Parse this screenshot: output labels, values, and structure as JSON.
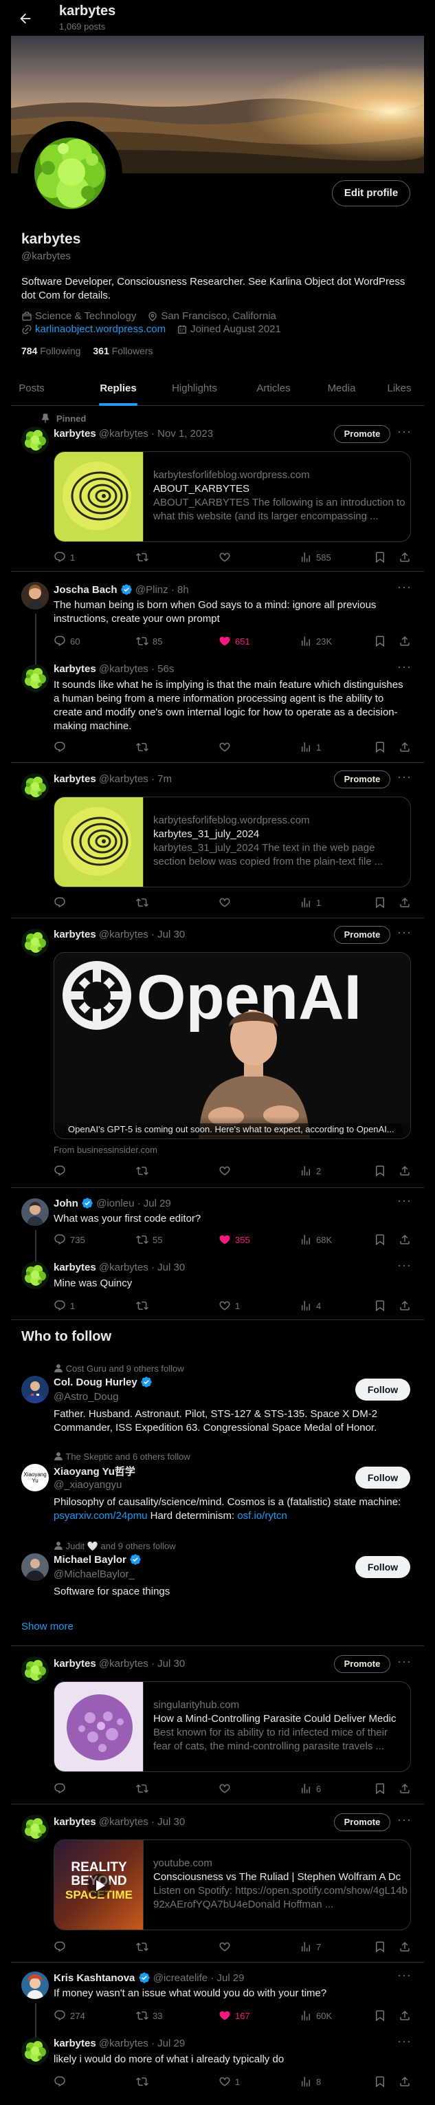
{
  "header": {
    "title": "karbytes",
    "post_count": "1,069 posts"
  },
  "profile": {
    "name": "karbytes",
    "handle": "@karbytes",
    "edit_label": "Edit profile",
    "bio": "Software Developer, Consciousness Researcher. See Karlina Object dot WordPress dot Com for details.",
    "category": "Science & Technology",
    "location": "San Francisco, California",
    "website": "karlinaobject.wordpress.com",
    "joined": "Joined August 2021",
    "following_count": "784",
    "following_label": "Following",
    "followers_count": "361",
    "followers_label": "Followers"
  },
  "tabs": [
    "Posts",
    "Replies",
    "Highlights",
    "Articles",
    "Media",
    "Likes"
  ],
  "active_tab": "Replies",
  "pinned_label": "Pinned",
  "tweets": {
    "t1": {
      "name": "karbytes",
      "handle": "@karbytes",
      "time": "· Nov 1, 2023",
      "promote": "Promote",
      "card_domain": "karbytesforlifeblog.wordpress.com",
      "card_title": "ABOUT_KARBYTES",
      "card_desc": "ABOUT_KARBYTES The following is an introduction to what this website (and its larger encompassing ...",
      "replies": "1",
      "retweets": "",
      "likes": "",
      "views": "585"
    },
    "t2": {
      "name": "Joscha Bach",
      "handle": "@Plinz",
      "time": "· 8h",
      "text": "The human being is born when God says to a mind: ignore all previous instructions, create your own prompt",
      "replies": "60",
      "retweets": "85",
      "likes": "651",
      "views": "23K"
    },
    "t3": {
      "name": "karbytes",
      "handle": "@karbytes",
      "time": "· 56s",
      "text": "It sounds like what he is implying is that the main feature which distinguishes a human being from a mere information processing agent is the ability to create and modify one's own internal logic for how to operate as a decision-making machine.",
      "replies": "",
      "retweets": "",
      "likes": "",
      "views": "1"
    },
    "t4": {
      "name": "karbytes",
      "handle": "@karbytes",
      "time": "· 7m",
      "promote": "Promote",
      "card_domain": "karbytesforlifeblog.wordpress.com",
      "card_title": "karbytes_31_july_2024",
      "card_desc": "karbytes_31_july_2024 The text in the web page section below was copied from the plain-text file ...",
      "replies": "",
      "retweets": "",
      "likes": "",
      "views": "1"
    },
    "t5": {
      "name": "karbytes",
      "handle": "@karbytes",
      "time": "· Jul 30",
      "promote": "Promote",
      "image_word": "OpenAI",
      "image_caption": "OpenAI's GPT-5 is coming out soon. Here's what to expect, according to OpenAI...",
      "source": "From businessinsider.com",
      "replies": "",
      "retweets": "",
      "likes": "",
      "views": "2"
    },
    "t6": {
      "name": "John",
      "handle": "@ionleu",
      "time": "· Jul 29",
      "text": "What was your first code editor?",
      "replies": "735",
      "retweets": "55",
      "likes": "355",
      "views": "68K"
    },
    "t7": {
      "name": "karbytes",
      "handle": "@karbytes",
      "time": "· Jul 30",
      "text": "Mine was Quincy",
      "replies": "1",
      "retweets": "",
      "likes": "1",
      "views": "4"
    },
    "t8": {
      "name": "karbytes",
      "handle": "@karbytes",
      "time": "· Jul 30",
      "promote": "Promote",
      "card_domain": "singularityhub.com",
      "card_title": "How a Mind-Controlling Parasite Could Deliver Medic",
      "card_desc": "Best known for its ability to rid infected mice of their fear of cats, the mind-controlling parasite travels ...",
      "replies": "",
      "retweets": "",
      "likes": "",
      "views": "6"
    },
    "t9": {
      "name": "karbytes",
      "handle": "@karbytes",
      "time": "· Jul 30",
      "promote": "Promote",
      "card_domain": "youtube.com",
      "card_title": "Consciousness vs The Ruliad | Stephen Wolfram A Dc",
      "card_desc": "Listen on Spotify: https://open.spotify.com/show/4gL14b92xAErofYQA7bU4eDonald Hoffman ...",
      "thumb_l1": "REALITY",
      "thumb_l2": "BEYOND",
      "thumb_l3": "SPACETIME",
      "replies": "",
      "retweets": "",
      "likes": "",
      "views": "7"
    },
    "t10": {
      "name": "Kris Kashtanova",
      "handle": "@icreatelife",
      "time": "· Jul 29",
      "text": "If money wasn't an issue what would you do with your time?",
      "replies": "274",
      "retweets": "33",
      "likes": "167",
      "views": "60K"
    },
    "t11": {
      "name": "karbytes",
      "handle": "@karbytes",
      "time": "· Jul 29",
      "text": "likely i would do more of what i already typically do",
      "replies": "",
      "retweets": "",
      "likes": "1",
      "views": "8"
    }
  },
  "who_to_follow": {
    "title": "Who to follow",
    "follow_label": "Follow",
    "show_more": "Show more",
    "users": [
      {
        "social": "Cost Guru and 9 others follow",
        "name": "Col. Doug Hurley",
        "handle": "@Astro_Doug",
        "bio": "Father. Husband. Astronaut. Pilot, STS-127 & STS-135. Space X DM-2 Commander, ISS Expedition 63. Congressional Space Medal of Honor."
      },
      {
        "social": "The Skeptic and 6 others follow",
        "name": "Xiaoyang Yu哲学",
        "handle": "@_xiaoyangyu",
        "bio_prefix": "Philosophy of causality/science/mind. Cosmos is a (fatalistic) state machine: ",
        "link1": "psyarxiv.com/24pmu",
        "bio_mid": " Hard determinism: ",
        "link2": "osf.io/rytcn",
        "avatar_text": "Xiaoyang Yu"
      },
      {
        "social": "Judit 🤍 and 9 others follow",
        "name": "Michael Baylor",
        "handle": "@MichaelBaylor_",
        "bio": "Software for space things"
      }
    ]
  },
  "colors": {
    "accent": "#1d9bf0",
    "like": "#f91880",
    "muted": "#71767b",
    "divider": "#2f3336"
  }
}
